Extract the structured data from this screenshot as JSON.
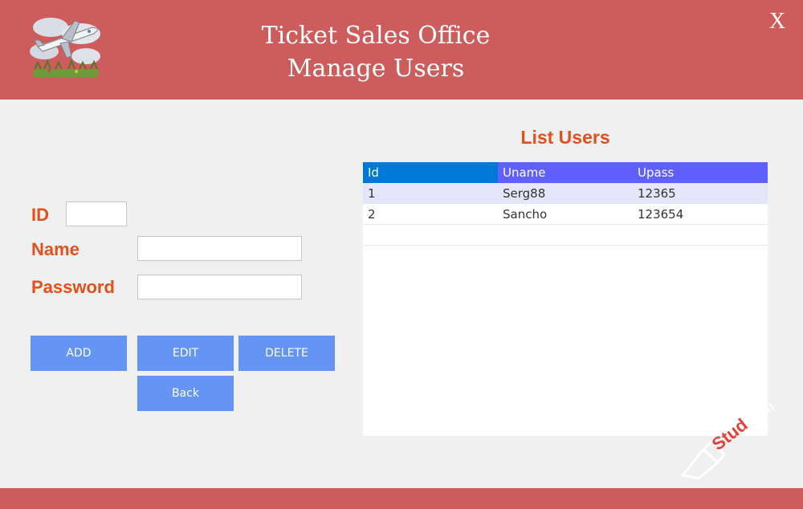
{
  "header": {
    "title_line1": "Ticket Sales Office",
    "title_line2": "Manage Users",
    "close_label": "X",
    "background_color": "#cd5c5c",
    "logo_icon": "airplane-logo-icon"
  },
  "form": {
    "id_label": "ID",
    "id_value": "",
    "name_label": "Name",
    "name_value": "",
    "password_label": "Password",
    "password_value": "",
    "label_color": "#e2501c"
  },
  "buttons": {
    "add": "ADD",
    "edit": "EDIT",
    "delete": "DELETE",
    "back": "Back",
    "color": "#6495f5"
  },
  "list": {
    "title": "List Users",
    "columns": [
      "Id",
      "Uname",
      "Upass"
    ],
    "rows": [
      [
        "1",
        "Serg88",
        "12365"
      ],
      [
        "2",
        "Sancho",
        "123654"
      ]
    ],
    "header_color": "#6060ff",
    "selected_header_color": "#0078d7",
    "alt_row_color": "#e6e6fa"
  },
  "watermark": {
    "text": "Stud",
    "text_suffix": "ium",
    "icon": "graduation-cap-icon"
  }
}
